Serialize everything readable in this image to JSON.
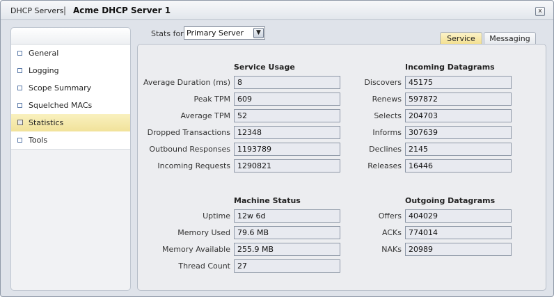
{
  "breadcrumb": {
    "root": "DHCP Servers",
    "separator": "|",
    "current": "Acme DHCP Server 1"
  },
  "close_glyph": "x",
  "sidebar": {
    "items": [
      {
        "label": "General",
        "active": false
      },
      {
        "label": "Logging",
        "active": false
      },
      {
        "label": "Scope Summary",
        "active": false
      },
      {
        "label": "Squelched MACs",
        "active": false
      },
      {
        "label": "Statistics",
        "active": true
      },
      {
        "label": "Tools",
        "active": false
      }
    ]
  },
  "stats_for": {
    "label": "Stats for",
    "selected": "Primary Server",
    "dropdown_glyph": "▼"
  },
  "tabs": [
    {
      "label": "Service",
      "active": true
    },
    {
      "label": "Messaging",
      "active": false
    }
  ],
  "service_usage": {
    "title": "Service Usage",
    "fields": [
      {
        "label": "Average Duration (ms)",
        "value": "8"
      },
      {
        "label": "Peak TPM",
        "value": "609"
      },
      {
        "label": "Average TPM",
        "value": "52"
      },
      {
        "label": "Dropped Transactions",
        "value": "12348"
      },
      {
        "label": "Outbound Responses",
        "value": "1193789"
      },
      {
        "label": "Incoming Requests",
        "value": "1290821"
      }
    ]
  },
  "incoming_datagrams": {
    "title": "Incoming Datagrams",
    "fields": [
      {
        "label": "Discovers",
        "value": "45175"
      },
      {
        "label": "Renews",
        "value": "597872"
      },
      {
        "label": "Selects",
        "value": "204703"
      },
      {
        "label": "Informs",
        "value": "307639"
      },
      {
        "label": "Declines",
        "value": "2145"
      },
      {
        "label": "Releases",
        "value": "16446"
      }
    ]
  },
  "machine_status": {
    "title": "Machine Status",
    "fields": [
      {
        "label": "Uptime",
        "value": "12w 6d"
      },
      {
        "label": "Memory Used",
        "value": "79.6 MB"
      },
      {
        "label": "Memory Available",
        "value": "255.9 MB"
      },
      {
        "label": "Thread Count",
        "value": "27"
      }
    ]
  },
  "outgoing_datagrams": {
    "title": "Outgoing Datagrams",
    "fields": [
      {
        "label": "Offers",
        "value": "404029"
      },
      {
        "label": "ACKs",
        "value": "774014"
      },
      {
        "label": "NAKs",
        "value": "20989"
      }
    ]
  }
}
